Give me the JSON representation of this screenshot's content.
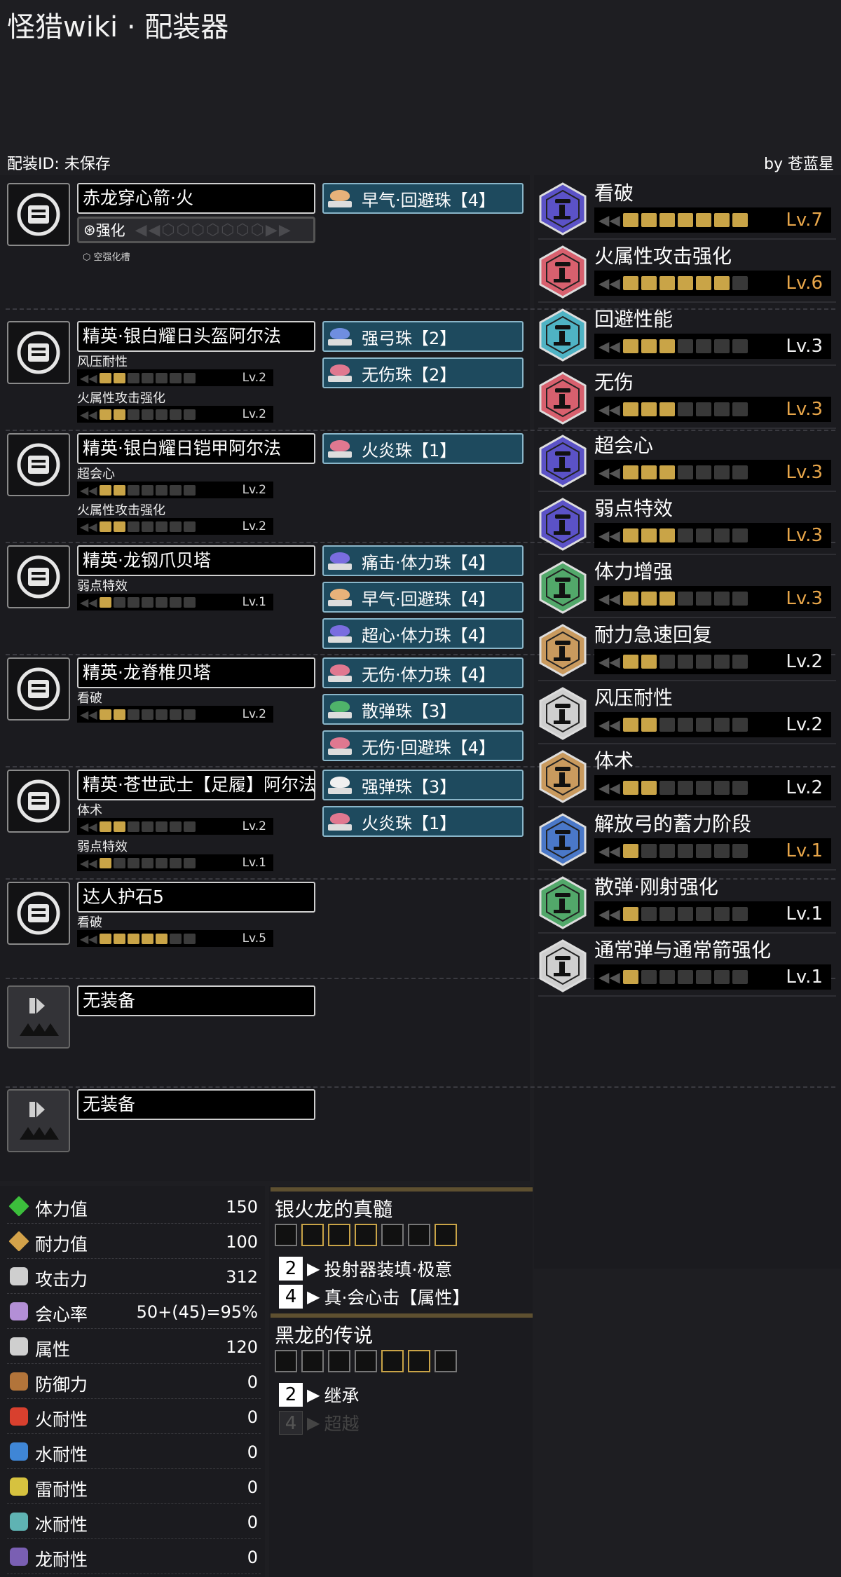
{
  "app": {
    "title": "怪猎wiki · 配装器",
    "build_id": "配装ID: 未保存",
    "author": "by 苍蓝星"
  },
  "weapon": {
    "name": "赤龙穿心箭·火",
    "reinforce_label": "强化",
    "slot_note": "空强化槽",
    "deco": "早气·回避珠【4】"
  },
  "head": {
    "name": "精英·银白耀日头盔阿尔法",
    "skills": [
      {
        "name": "风压耐性",
        "level": "Lv.2",
        "value": 2
      },
      {
        "name": "火属性攻击强化",
        "level": "Lv.2",
        "value": 2
      }
    ],
    "decos": [
      "强弓珠【2】",
      "无伤珠【2】"
    ]
  },
  "chest": {
    "name": "精英·银白耀日铠甲阿尔法",
    "skills": [
      {
        "name": "超会心",
        "level": "Lv.2",
        "value": 2
      },
      {
        "name": "火属性攻击强化",
        "level": "Lv.2",
        "value": 2
      }
    ],
    "decos": [
      "火炎珠【1】"
    ]
  },
  "arms": {
    "name": "精英·龙钢爪贝塔",
    "skills": [
      {
        "name": "弱点特效",
        "level": "Lv.1",
        "value": 1
      }
    ],
    "decos": [
      "痛击·体力珠【4】",
      "早气·回避珠【4】",
      "超心·体力珠【4】"
    ]
  },
  "waist": {
    "name": "精英·龙脊椎贝塔",
    "skills": [
      {
        "name": "看破",
        "level": "Lv.2",
        "value": 2
      }
    ],
    "decos": [
      "无伤·体力珠【4】",
      "散弹珠【3】",
      "无伤·回避珠【4】"
    ]
  },
  "legs": {
    "name": "精英·苍世武士【足履】阿尔法",
    "skills": [
      {
        "name": "体术",
        "level": "Lv.2",
        "value": 2
      },
      {
        "name": "弱点特效",
        "level": "Lv.1",
        "value": 1
      }
    ],
    "decos": [
      "强弹珠【3】",
      "火炎珠【1】"
    ]
  },
  "charm": {
    "name": "达人护石5",
    "skills": [
      {
        "name": "看破",
        "level": "Lv.5",
        "value": 5
      }
    ]
  },
  "empty_slots": [
    "无装备",
    "无装备"
  ],
  "skill_summary": [
    {
      "name": "看破",
      "level": "Lv.7",
      "value": 7,
      "max": true,
      "color": "#5b52c7"
    },
    {
      "name": "火属性攻击强化",
      "level": "Lv.6",
      "value": 6,
      "max": true,
      "color": "#d8606e"
    },
    {
      "name": "回避性能",
      "level": "Lv.3",
      "value": 3,
      "max": false,
      "color": "#4fb3c4"
    },
    {
      "name": "无伤",
      "level": "Lv.3",
      "value": 3,
      "max": true,
      "color": "#d8606e"
    },
    {
      "name": "超会心",
      "level": "Lv.3",
      "value": 3,
      "max": true,
      "color": "#5b52c7"
    },
    {
      "name": "弱点特效",
      "level": "Lv.3",
      "value": 3,
      "max": true,
      "color": "#5b52c7"
    },
    {
      "name": "体力增强",
      "level": "Lv.3",
      "value": 3,
      "max": true,
      "color": "#52a86a"
    },
    {
      "name": "耐力急速回复",
      "level": "Lv.2",
      "value": 2,
      "max": false,
      "color": "#c99a5e"
    },
    {
      "name": "风压耐性",
      "level": "Lv.2",
      "value": 2,
      "max": false,
      "color": "#cfcfcf"
    },
    {
      "name": "体术",
      "level": "Lv.2",
      "value": 2,
      "max": false,
      "color": "#c99a5e"
    },
    {
      "name": "解放弓的蓄力阶段",
      "level": "Lv.1",
      "value": 1,
      "max": true,
      "color": "#4a78c8"
    },
    {
      "name": "散弹·刚射强化",
      "level": "Lv.1",
      "value": 1,
      "max": false,
      "color": "#52a86a"
    },
    {
      "name": "通常弹与通常箭强化",
      "level": "Lv.1",
      "value": 1,
      "max": false,
      "color": "#cfcfcf"
    }
  ],
  "stats": [
    {
      "label": "体力值",
      "value": "150",
      "icon": "health-icon",
      "color": "#3cbf3c"
    },
    {
      "label": "耐力值",
      "value": "100",
      "icon": "stamina-icon",
      "color": "#d3a24a"
    },
    {
      "label": "攻击力",
      "value": "312",
      "icon": "attack-icon",
      "color": "#cfcfcf"
    },
    {
      "label": "会心率",
      "value": "50+(45)=95%",
      "icon": "affinity-icon",
      "color": "#b38fd6"
    },
    {
      "label": "属性",
      "value": "120",
      "icon": "element-icon",
      "color": "#cfcfcf"
    },
    {
      "label": "防御力",
      "value": "0",
      "icon": "defense-icon",
      "color": "#b2743a"
    },
    {
      "label": "火耐性",
      "value": "0",
      "icon": "fire-res-icon",
      "color": "#d8402e"
    },
    {
      "label": "水耐性",
      "value": "0",
      "icon": "water-res-icon",
      "color": "#3f86d6"
    },
    {
      "label": "雷耐性",
      "value": "0",
      "icon": "thunder-res-icon",
      "color": "#d6c23f"
    },
    {
      "label": "冰耐性",
      "value": "0",
      "icon": "ice-res-icon",
      "color": "#5fb3b3"
    },
    {
      "label": "龙耐性",
      "value": "0",
      "icon": "dragon-res-icon",
      "color": "#7a5fb3"
    }
  ],
  "set_bonuses": [
    {
      "title": "银火龙的真髓",
      "skills": [
        {
          "count": "2",
          "name": "投射器装填·极意",
          "active": true
        },
        {
          "count": "4",
          "name": "真·会心击【属性】",
          "active": true
        }
      ]
    },
    {
      "title": "黑龙的传说",
      "skills": [
        {
          "count": "2",
          "name": "继承",
          "active": true
        },
        {
          "count": "4",
          "name": "超越",
          "active": false
        }
      ]
    }
  ]
}
